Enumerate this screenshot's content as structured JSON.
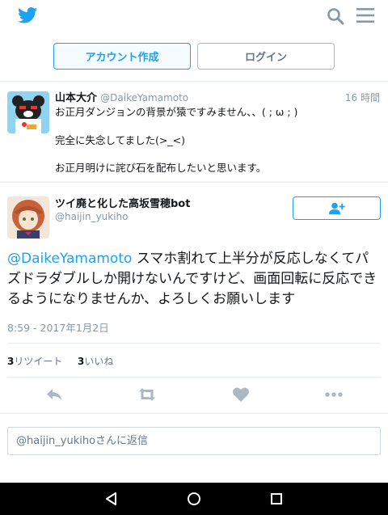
{
  "header": {
    "signup_label": "アカウント作成",
    "login_label": "ログイン"
  },
  "tweet1": {
    "name": "山本大介",
    "handle": "@DaikeYamamoto",
    "time": "16 時間",
    "lines": [
      "お正月ダンジョンの背景が猿ですみません、、( ; ω ; )",
      "完全に失念してました(>_<)",
      "お正月明けに詫び石を配布したいと思います。"
    ]
  },
  "tweet2": {
    "name": "ツイ廃と化した高坂雪穂bot",
    "handle": "@haijin_yukiho",
    "mention": "@DaikeYamamoto",
    "text": " スマホ割れて上半分が反応しなくてパズドラダブルしか開けないんですけど、画面回転に反応できるようになりませんか、よろしくお願いします",
    "date": "8:59 - 2017年1月2日",
    "retweet_count": "3",
    "retweet_label": "リツイート",
    "like_count": "3",
    "like_label": "いいね"
  },
  "reply": {
    "placeholder": "@haijin_yukihoさんに返信"
  },
  "colors": {
    "accent": "#1da1f2",
    "action_icon": "#aab8c2"
  },
  "icons": [
    "twitter-bird-icon",
    "search-icon",
    "menu-icon",
    "follow-icon",
    "reply-icon",
    "retweet-icon",
    "like-icon",
    "more-icon",
    "back-icon",
    "home-icon",
    "recents-icon"
  ]
}
